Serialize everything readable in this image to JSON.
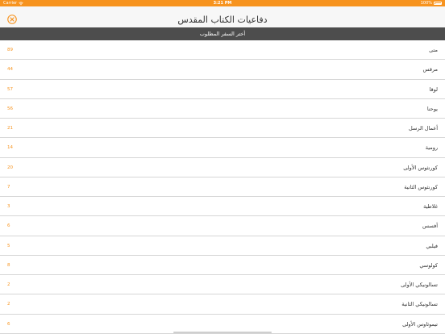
{
  "status_bar": {
    "carrier": "Carrier",
    "time": "3:21 PM",
    "battery": "100%"
  },
  "nav": {
    "title": "دفاعيات الكتاب المقدس",
    "close_icon": "close-circle-icon",
    "accent_color": "#f7931e"
  },
  "section_header": {
    "label": "أختر السفر المطلوب"
  },
  "books": [
    {
      "name": "متى",
      "count": "89"
    },
    {
      "name": "مرقس",
      "count": "44"
    },
    {
      "name": "لوقا",
      "count": "57"
    },
    {
      "name": "يوحنا",
      "count": "56"
    },
    {
      "name": "أعمال الرسل",
      "count": "21"
    },
    {
      "name": "رومية",
      "count": "14"
    },
    {
      "name": "كورنثوس الأولى",
      "count": "20"
    },
    {
      "name": "كورنثوس الثانية",
      "count": "7"
    },
    {
      "name": "غلاطية",
      "count": "3"
    },
    {
      "name": "أفسس",
      "count": "6"
    },
    {
      "name": "فيلبي",
      "count": "5"
    },
    {
      "name": "كولوسي",
      "count": "8"
    },
    {
      "name": "تسالونيكي الأولى",
      "count": "2"
    },
    {
      "name": "تسالونيكي الثانية",
      "count": "2"
    },
    {
      "name": "تيموثاوس الأولى",
      "count": "6"
    }
  ]
}
